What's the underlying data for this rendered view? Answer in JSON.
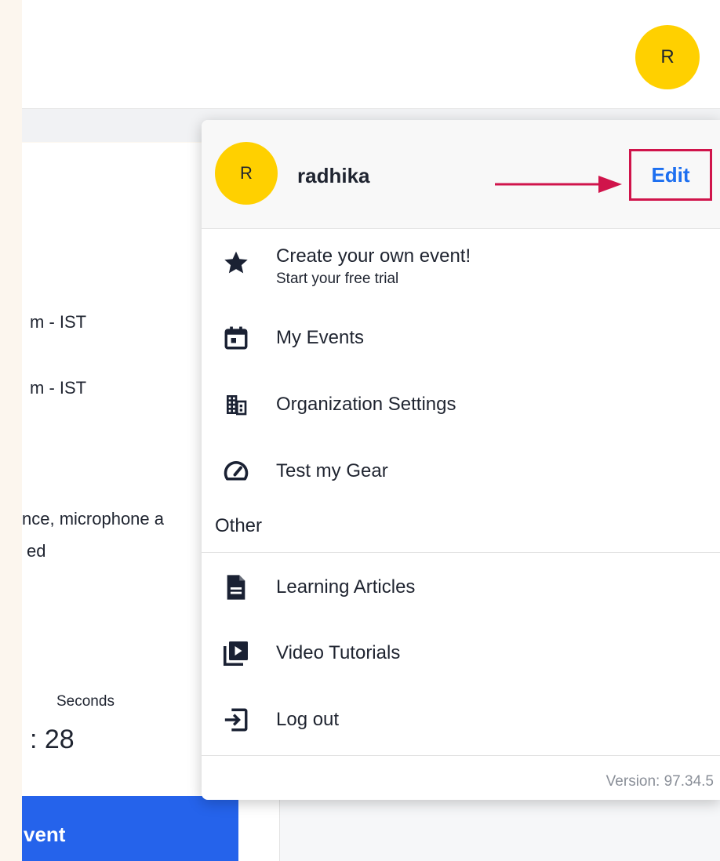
{
  "header": {
    "avatar_initial": "R"
  },
  "background": {
    "rows": [
      "m - IST",
      "m - IST",
      "nce, microphone a",
      "ed"
    ],
    "countdown": {
      "label": "Seconds",
      "value": ":  28"
    },
    "button_label": "vent"
  },
  "dropdown": {
    "user": {
      "initial": "R",
      "name": "radhika",
      "edit_label": "Edit"
    },
    "items": [
      {
        "label": "Create your own event!",
        "sublabel": "Start your free trial",
        "icon": "star-icon"
      },
      {
        "label": "My Events",
        "icon": "calendar-icon"
      },
      {
        "label": "Organization Settings",
        "icon": "building-icon"
      },
      {
        "label": "Test my Gear",
        "icon": "speedometer-icon"
      }
    ],
    "other_label": "Other",
    "other_items": [
      {
        "label": "Learning Articles",
        "icon": "document-icon"
      },
      {
        "label": "Video Tutorials",
        "icon": "video-library-icon"
      },
      {
        "label": "Log out",
        "icon": "logout-icon"
      }
    ],
    "version": "Version: 97.34.5"
  },
  "colors": {
    "avatar": "#ffd000",
    "edit_text": "#1d6ff0",
    "highlight_box": "#d0144b",
    "primary_button": "#2563eb"
  }
}
